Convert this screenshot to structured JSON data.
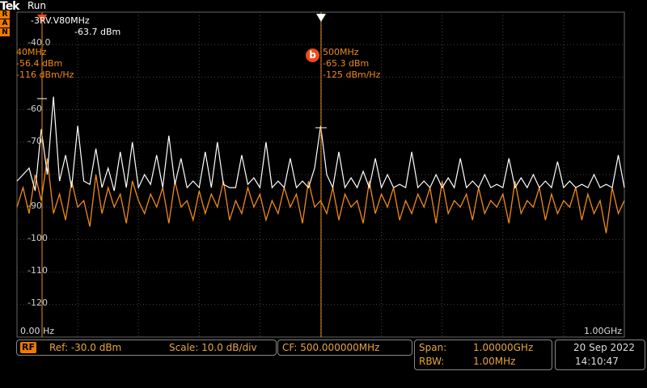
{
  "header": {
    "brand": "Tek",
    "status": "Run",
    "trig_badges": [
      "R",
      "A",
      "N"
    ]
  },
  "markers": {
    "top_label": "-3RV.V80MHz",
    "ref_readout_amp": "-63.7 dBm",
    "a": {
      "freq": "40MHz",
      "amp": "-56.4 dBm",
      "density": "-116 dBm/Hz"
    },
    "b": {
      "letter": "b",
      "freq": "500MHz",
      "amp": "-65.3 dBm",
      "density": "-125 dBm/Hz"
    }
  },
  "y_axis": {
    "ticks": [
      "-40.0",
      "-60",
      "-70",
      "-90",
      "-100",
      "-110",
      "-120"
    ]
  },
  "x_axis": {
    "start": "0.00 Hz",
    "stop": "1.00GHz"
  },
  "status_bar": {
    "rf_badge": "RF",
    "ref": "Ref: -30.0 dBm",
    "scale": "Scale: 10.0 dB/div",
    "cf": "CF:  500.000000MHz",
    "span_label": "Span:",
    "span_value": "1.00000GHz",
    "rbw_label": "RBW:",
    "rbw_value": "1.00MHz",
    "date": "20 Sep  2022",
    "time": "14:10:47"
  },
  "colors": {
    "trace_live": "#ffffff",
    "trace_max": "#ef8a1a",
    "marker": "#ef8a1a",
    "grid": "#555555"
  },
  "chart_data": {
    "type": "line",
    "xlabel": "",
    "ylabel": "",
    "x_range_hz": [
      0,
      1000000000
    ],
    "y_range_dbm": [
      -130,
      -30
    ],
    "series": [
      {
        "values_dbm": [
          -82,
          -80,
          -78,
          -85,
          -66,
          -80,
          -56,
          -82,
          -74,
          -84,
          -65,
          -82,
          -83,
          -72,
          -84,
          -78,
          -85,
          -73,
          -84,
          -70,
          -84,
          -80,
          -83,
          -74,
          -84,
          -68,
          -83,
          -75,
          -84,
          -82,
          -84,
          -73,
          -84,
          -70,
          -83,
          -84,
          -84,
          -74,
          -83,
          -81,
          -84,
          -70,
          -84,
          -82,
          -84,
          -75,
          -84,
          -82,
          -84,
          -78,
          -65,
          -80,
          -84,
          -73,
          -84,
          -81,
          -84,
          -79,
          -84,
          -75,
          -84,
          -80,
          -84,
          -83,
          -84,
          -73,
          -84,
          -82,
          -84,
          -80,
          -84,
          -81,
          -84,
          -75,
          -84,
          -82,
          -84,
          -80,
          -84,
          -83,
          -84,
          -75,
          -84,
          -81,
          -84,
          -80,
          -84,
          -82,
          -84,
          -76,
          -84,
          -82,
          -84,
          -83,
          -84,
          -80,
          -84,
          -83,
          -84,
          -74,
          -84
        ]
      },
      {
        "values_dbm": [
          -90,
          -84,
          -92,
          -80,
          -88,
          -75,
          -92,
          -86,
          -94,
          -82,
          -90,
          -88,
          -96,
          -80,
          -92,
          -84,
          -90,
          -86,
          -95,
          -82,
          -88,
          -92,
          -86,
          -90,
          -84,
          -95,
          -82,
          -90,
          -88,
          -94,
          -85,
          -92,
          -86,
          -90,
          -82,
          -94,
          -88,
          -92,
          -84,
          -90,
          -86,
          -94,
          -88,
          -92,
          -84,
          -90,
          -86,
          -95,
          -82,
          -90,
          -88,
          -92,
          -84,
          -94,
          -86,
          -90,
          -88,
          -95,
          -82,
          -92,
          -86,
          -90,
          -84,
          -94,
          -88,
          -92,
          -86,
          -90,
          -84,
          -95,
          -82,
          -92,
          -88,
          -90,
          -86,
          -94,
          -84,
          -92,
          -88,
          -90,
          -86,
          -95,
          -82,
          -92,
          -88,
          -90,
          -84,
          -94,
          -86,
          -92,
          -88,
          -90,
          -84,
          -94,
          -86,
          -92,
          -88,
          -98,
          -84,
          -92,
          -88
        ]
      }
    ]
  }
}
